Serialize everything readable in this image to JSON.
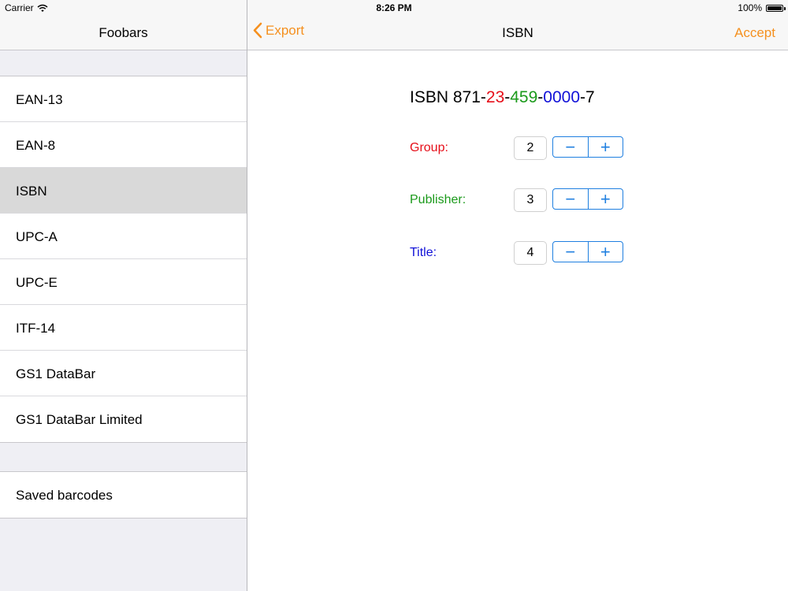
{
  "status": {
    "carrier": "Carrier",
    "time": "8:26 PM",
    "battery": "100%"
  },
  "master": {
    "title": "Foobars",
    "items": [
      {
        "label": "EAN-13",
        "selected": false
      },
      {
        "label": "EAN-8",
        "selected": false
      },
      {
        "label": "ISBN",
        "selected": true
      },
      {
        "label": "UPC-A",
        "selected": false
      },
      {
        "label": "UPC-E",
        "selected": false
      },
      {
        "label": "ITF-14",
        "selected": false
      },
      {
        "label": "GS1 DataBar",
        "selected": false
      },
      {
        "label": "GS1 DataBar Limited",
        "selected": false
      }
    ],
    "saved": {
      "label": "Saved barcodes"
    }
  },
  "detail": {
    "back_label": "Export",
    "title": "ISBN",
    "accept_label": "Accept",
    "isbn": {
      "prefix_text": "ISBN 871-",
      "group": "23",
      "sep1": "-",
      "publisher": "459",
      "sep2": "-",
      "title": "0000",
      "suffix": "-7"
    },
    "params": {
      "group": {
        "label": "Group:",
        "value": "2"
      },
      "publisher": {
        "label": "Publisher:",
        "value": "3"
      },
      "title": {
        "label": "Title:",
        "value": "4"
      }
    },
    "stepper": {
      "minus": "−",
      "plus": "+"
    }
  },
  "colors": {
    "accent": "#f5901f",
    "group": "#e60f1a",
    "publisher": "#1b9a1b",
    "title": "#1212d8",
    "stepper": "#1f7fe0",
    "selected_row": "#d9d9d9"
  }
}
